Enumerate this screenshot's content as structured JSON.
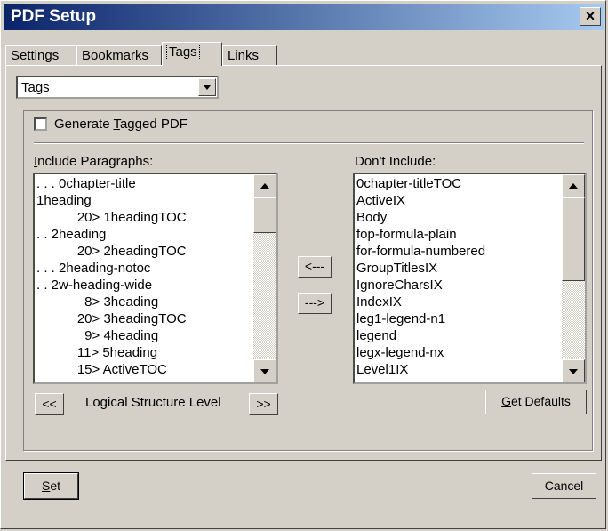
{
  "window": {
    "title": "PDF Setup"
  },
  "tabs": [
    "Settings",
    "Bookmarks",
    "Tags",
    "Links"
  ],
  "active_tab": "Tags",
  "tag_select": {
    "value": "Tags"
  },
  "generate_tagged": {
    "pre": "Generate ",
    "key": "T",
    "post": "agged PDF",
    "checked": false
  },
  "include": {
    "label_key": "I",
    "label_rest": "nclude Paragraphs:",
    "items": [
      ". . . 0chapter-title",
      "1heading",
      "           20> 1headingTOC",
      ". . 2heading",
      "           20> 2headingTOC",
      ". . . 2heading-notoc",
      ". . 2w-heading-wide",
      "             8> 3heading",
      "           20> 3headingTOC",
      "             9> 4heading",
      "           11> 5heading",
      "           15> ActiveTOC"
    ]
  },
  "exclude": {
    "label": "Don't Include:",
    "items": [
      "0chapter-titleTOC",
      "ActiveIX",
      "Body",
      "fop-formula-plain",
      "for-formula-numbered",
      "GroupTitlesIX",
      "IgnoreCharsIX",
      "IndexIX",
      "leg1-legend-n1",
      "legend",
      "legx-legend-nx",
      "Level1IX"
    ]
  },
  "move_left_label": "<---",
  "move_right_label": "--->",
  "level": {
    "less_label": "<<",
    "text": "Logical Structure Level",
    "more_label": ">>"
  },
  "get_defaults": {
    "key": "G",
    "rest": "et Defaults"
  },
  "set_button": {
    "key": "S",
    "rest": "et"
  },
  "cancel_button": "Cancel"
}
